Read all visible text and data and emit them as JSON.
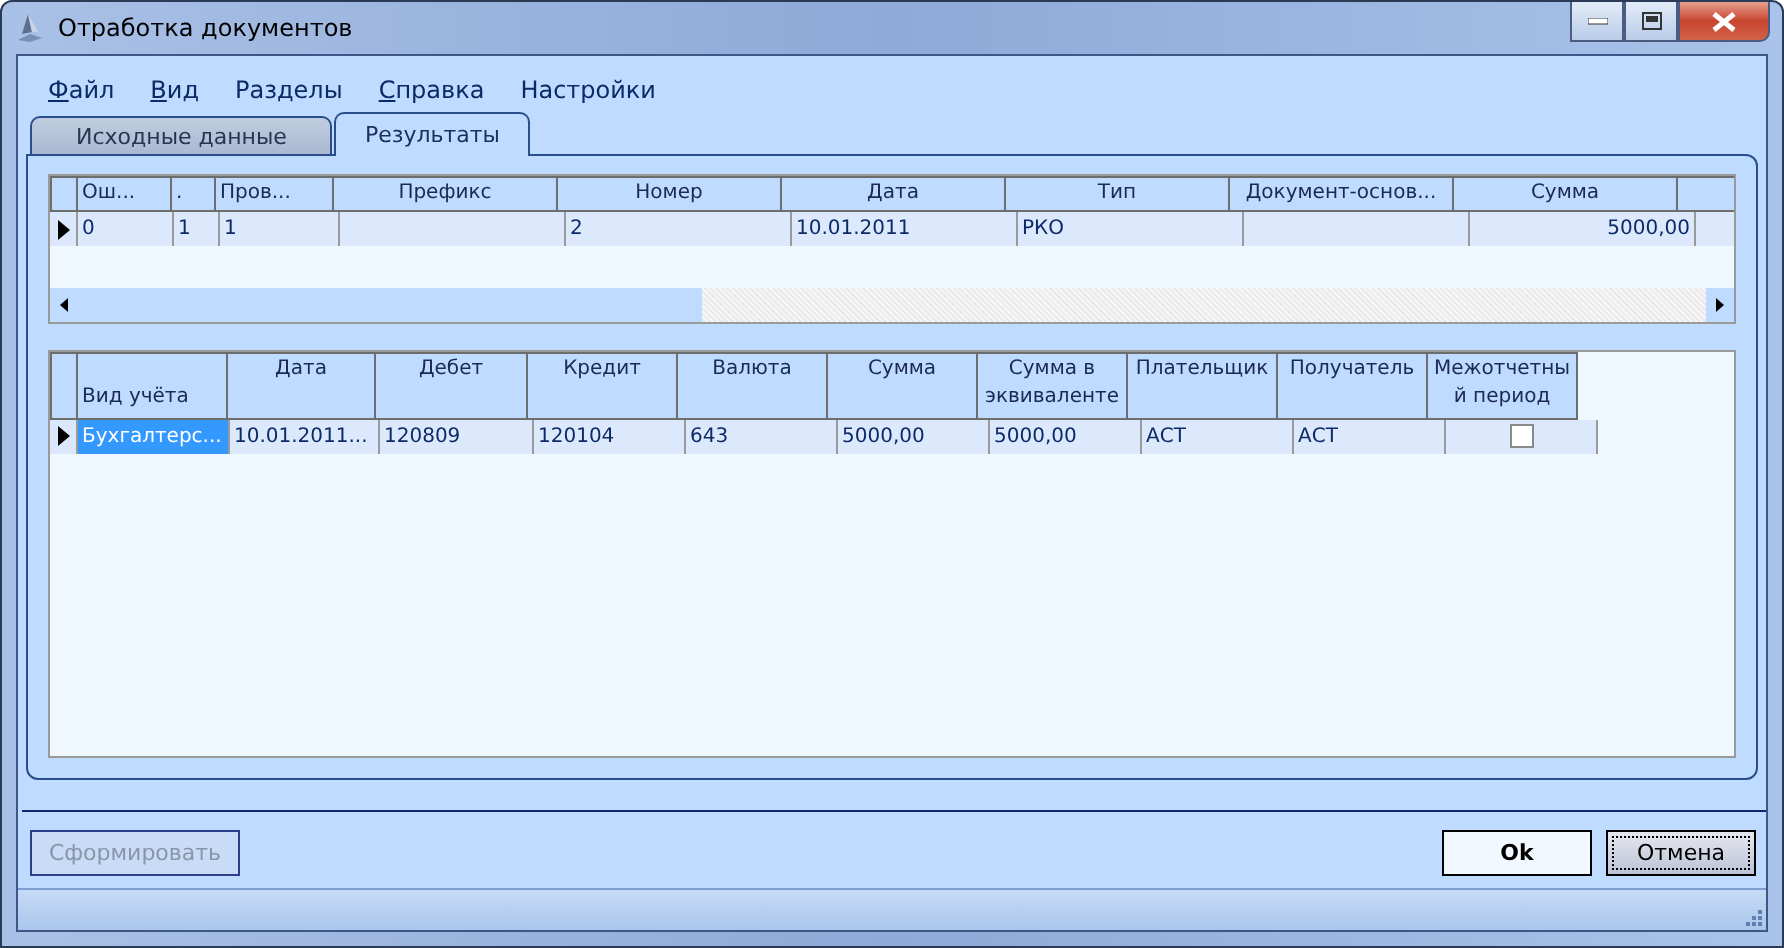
{
  "window": {
    "title": "Отработка документов"
  },
  "menu": [
    {
      "label": "Файл",
      "underlined": true
    },
    {
      "label": "Вид",
      "underlined": true
    },
    {
      "label": "Разделы",
      "underlined": false
    },
    {
      "label": "Справка",
      "underlined": true
    },
    {
      "label": "Настройки",
      "underlined": false
    }
  ],
  "tabs": [
    {
      "label": "Исходные данные",
      "selected": false
    },
    {
      "label": "Результаты",
      "selected": true
    }
  ],
  "documents_table": {
    "columns": [
      "Ош...",
      ".",
      "Пров...",
      "Префикс",
      "Номер",
      "Дата",
      "Тип",
      "Документ-основ...",
      "Сумма",
      ""
    ],
    "rows": [
      {
        "current": true,
        "cells": [
          "0",
          "1",
          "1",
          "",
          "2",
          "10.01.2011",
          "РКО",
          "",
          "5000,00",
          ""
        ]
      }
    ]
  },
  "entries_table": {
    "columns": [
      "Вид учёта",
      "Дата",
      "Дебет",
      "Кредит",
      "Валюта",
      "Сумма",
      "Сумма в эквиваленте",
      "Плательщик",
      "Получатель",
      "Межотчетный период"
    ],
    "rows": [
      {
        "current": true,
        "cells": [
          {
            "kind": "text",
            "text": "Бухгалтерс...",
            "selected": true
          },
          {
            "kind": "text",
            "text": "10.01.2011...",
            "selected": false
          },
          {
            "kind": "text",
            "text": "120809",
            "selected": false
          },
          {
            "kind": "text",
            "text": "120104",
            "selected": false
          },
          {
            "kind": "text",
            "text": "643",
            "selected": false
          },
          {
            "kind": "text",
            "text": "5000,00",
            "selected": false
          },
          {
            "kind": "text",
            "text": "5000,00",
            "selected": false
          },
          {
            "kind": "text",
            "text": "АСТ",
            "selected": false
          },
          {
            "kind": "text",
            "text": "АСТ",
            "selected": false
          },
          {
            "kind": "checkbox",
            "checked": false
          }
        ]
      }
    ]
  },
  "buttons": [
    {
      "label": "Сформировать",
      "disabled": true,
      "default": false,
      "focused": false
    },
    {
      "label": "Ok",
      "disabled": false,
      "default": true,
      "focused": false
    },
    {
      "label": "Отмена",
      "disabled": false,
      "default": false,
      "focused": true
    }
  ]
}
